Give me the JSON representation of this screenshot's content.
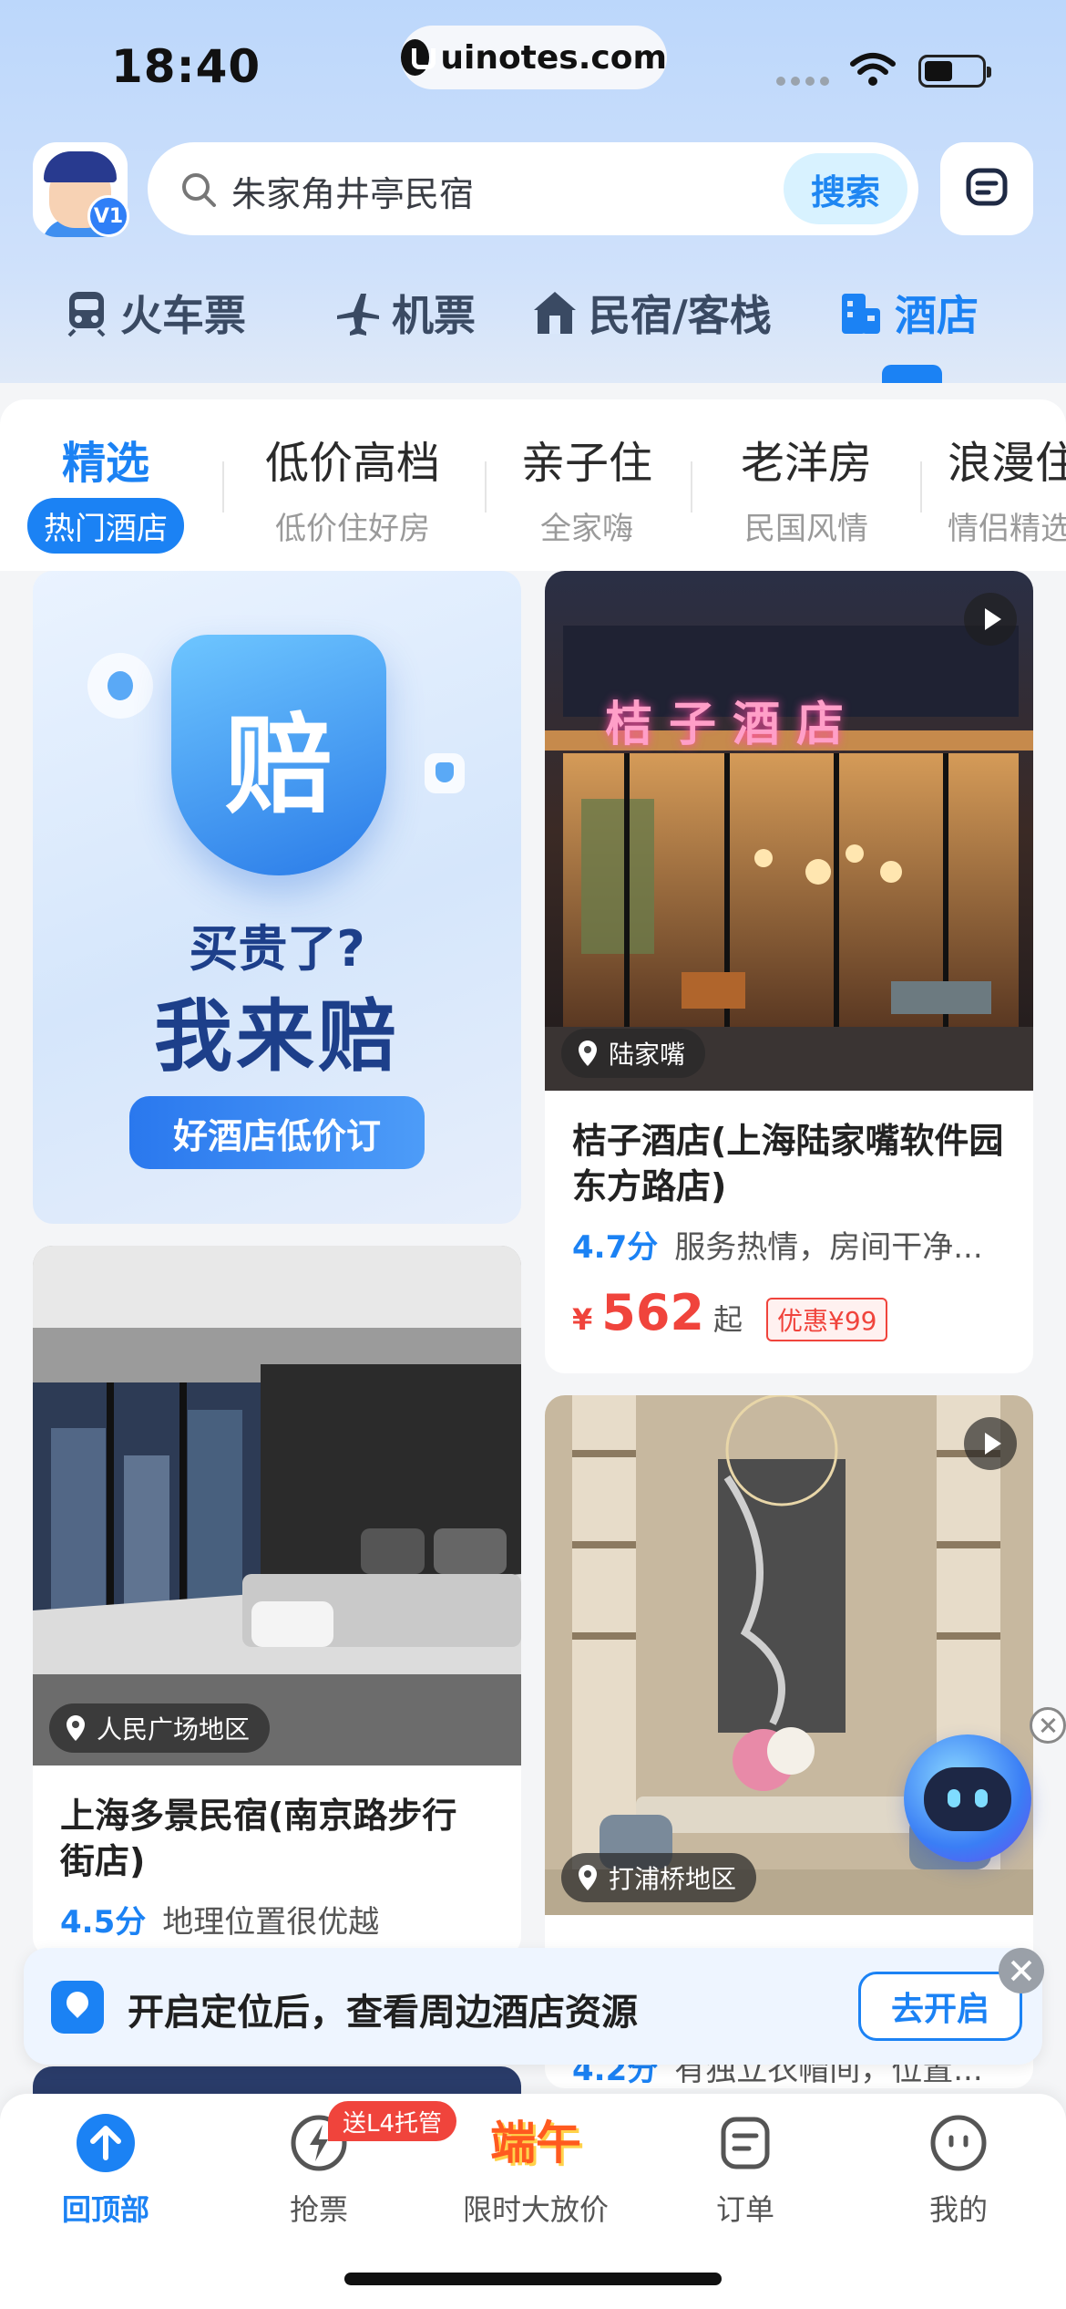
{
  "status_bar": {
    "time": "18:40",
    "url": "uinotes.com"
  },
  "header": {
    "badge": "V1",
    "search_placeholder": "朱家角井亭民宿",
    "search_button": "搜索"
  },
  "category_tabs": [
    {
      "label": "火车票",
      "icon": "train-icon"
    },
    {
      "label": "机票",
      "icon": "plane-icon"
    },
    {
      "label": "民宿/客栈",
      "icon": "house-icon"
    },
    {
      "label": "酒店",
      "icon": "hotel-icon",
      "active": true
    }
  ],
  "sub_tabs": [
    {
      "title": "精选",
      "subtitle": "热门酒店",
      "active": true
    },
    {
      "title": "低价高档",
      "subtitle": "低价住好房"
    },
    {
      "title": "亲子住",
      "subtitle": "全家嗨"
    },
    {
      "title": "老洋房",
      "subtitle": "民国风情"
    },
    {
      "title": "浪漫住",
      "subtitle": "情侣精选"
    }
  ],
  "promo": {
    "shield_char": "赔",
    "line1": "买贵了?",
    "line2": "我来赔",
    "button": "好酒店低价订"
  },
  "hotels": [
    {
      "sign": "桔子酒店",
      "location": "陆家嘴",
      "name": "桔子酒店(上海陆家嘴软件园东方路店)",
      "score": "4.7分",
      "review": "服务热情，房间干净...",
      "currency": "¥",
      "price": "562",
      "price_suffix": "起",
      "discount": "优惠¥99"
    },
    {
      "location": "人民广场地区",
      "name": "上海多景民宿(南京路步行街店)",
      "score": "4.5分",
      "review": "地理位置很优越"
    },
    {
      "location": "打浦桥地区",
      "score": "4.2分",
      "review": "有独立衣帽间，位置..."
    }
  ],
  "location_banner": {
    "text": "开启定位后，查看周边酒店资源",
    "button": "去开启"
  },
  "bottom_nav": [
    {
      "label": "回顶部",
      "icon": "arrow-up-icon",
      "active": true
    },
    {
      "label": "抢票",
      "icon": "lightning-icon",
      "badge": "送L4托管"
    },
    {
      "label": "限时大放价",
      "icon": "duanwu-icon",
      "art_text": "端午"
    },
    {
      "label": "订单",
      "icon": "order-icon"
    },
    {
      "label": "我的",
      "icon": "profile-icon"
    }
  ],
  "colors": {
    "primary": "#1b82f4",
    "price": "#f0443c",
    "header_bg": "#bcd7fb"
  }
}
